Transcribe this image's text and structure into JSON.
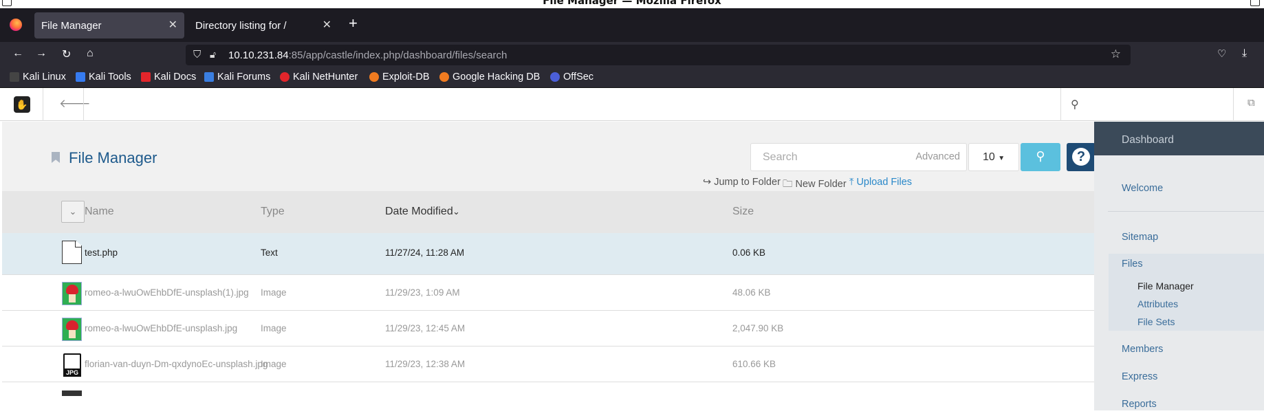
{
  "window": {
    "title": "File Manager — Mozilla Firefox"
  },
  "tabs": [
    {
      "label": "File Manager",
      "active": true
    },
    {
      "label": "Directory listing for /",
      "active": false
    }
  ],
  "url": {
    "host": "10.10.231.84",
    "rest": ":85/app/castle/index.php/dashboard/files/search"
  },
  "bookmarks": [
    {
      "label": "Kali Linux",
      "color": "#2b2a33"
    },
    {
      "label": "Kali Tools",
      "color": "#367bf0"
    },
    {
      "label": "Kali Docs",
      "color": "#e2252b"
    },
    {
      "label": "Kali Forums",
      "color": "#3a7ee0"
    },
    {
      "label": "Kali NetHunter",
      "color": "#e2252b"
    },
    {
      "label": "Exploit-DB",
      "color": "#f07b20"
    },
    {
      "label": "Google Hacking DB",
      "color": "#f07b20"
    },
    {
      "label": "OffSec",
      "color": "#4b5fd8"
    }
  ],
  "page": {
    "title": "File Manager",
    "search_placeholder": "Search",
    "advanced": "Advanced",
    "per_page": "10",
    "actions": {
      "jump": "Jump to Folder",
      "new_folder": "New Folder",
      "upload": "Upload Files"
    }
  },
  "table": {
    "headers": {
      "name": "Name",
      "type": "Type",
      "date": "Date Modified",
      "size": "Size"
    },
    "rows": [
      {
        "name": "test.php",
        "type": "Text",
        "date": "11/27/24, 11:28 AM",
        "size": "0.06 KB",
        "icon": "document-icon"
      },
      {
        "name": "romeo-a-lwuOwEhbDfE-unsplash(1).jpg",
        "type": "Image",
        "date": "11/29/23, 1:09 AM",
        "size": "48.06 KB",
        "icon": "image-thumbnail"
      },
      {
        "name": "romeo-a-lwuOwEhbDfE-unsplash.jpg",
        "type": "Image",
        "date": "11/29/23, 12:45 AM",
        "size": "2,047.90 KB",
        "icon": "image-thumbnail"
      },
      {
        "name": "florian-van-duyn-Dm-qxdynoEc-unsplash.jpg",
        "type": "Image",
        "date": "11/29/23, 12:38 AM",
        "size": "610.66 KB",
        "icon": "jpg-file-icon"
      }
    ]
  },
  "sidebar": {
    "header": "Dashboard",
    "items": [
      "Welcome",
      "Sitemap",
      "Files",
      "Members",
      "Express",
      "Reports"
    ],
    "files_sub": [
      "File Manager",
      "Attributes",
      "File Sets"
    ]
  }
}
